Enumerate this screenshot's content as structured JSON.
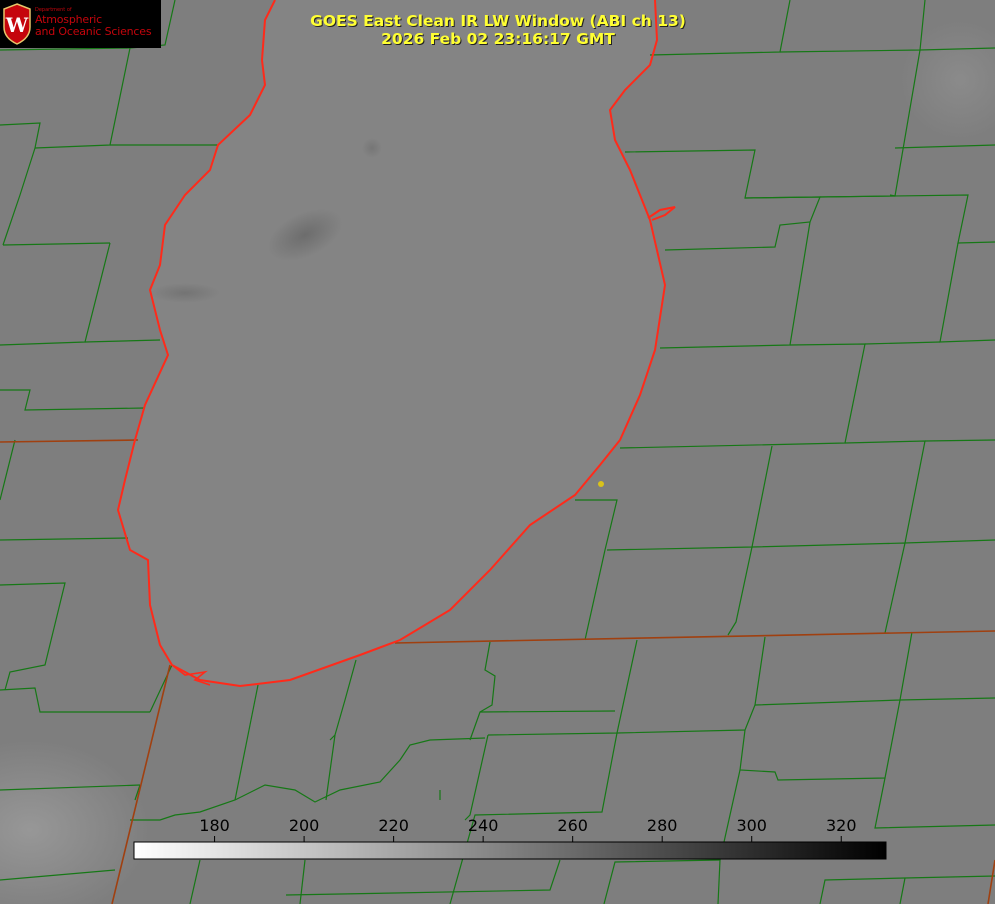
{
  "title": {
    "line1": "GOES East Clean IR LW Window (ABI ch 13)",
    "line2": "2026 Feb 02 23:16:17 GMT"
  },
  "logo": {
    "dept": "Department of",
    "line1": "Atmospheric",
    "line2": "and Oceanic Sciences",
    "seal_letter": "W"
  },
  "colorbar": {
    "min": 162,
    "max": 330,
    "ticks": [
      180,
      200,
      220,
      240,
      260,
      280,
      300,
      320
    ],
    "tick_labels": [
      "180",
      "200",
      "220",
      "240",
      "260",
      "280",
      "300",
      "320"
    ],
    "low_color": "#ffffff",
    "high_color": "#000000"
  },
  "colors": {
    "county_lines": "#167816",
    "state_lines": "#a04010",
    "lake_shoreline": "#ff2a1a",
    "station_marker": "#d9c21a",
    "title_text": "#ffff33",
    "logo_text": "#c5050c"
  }
}
